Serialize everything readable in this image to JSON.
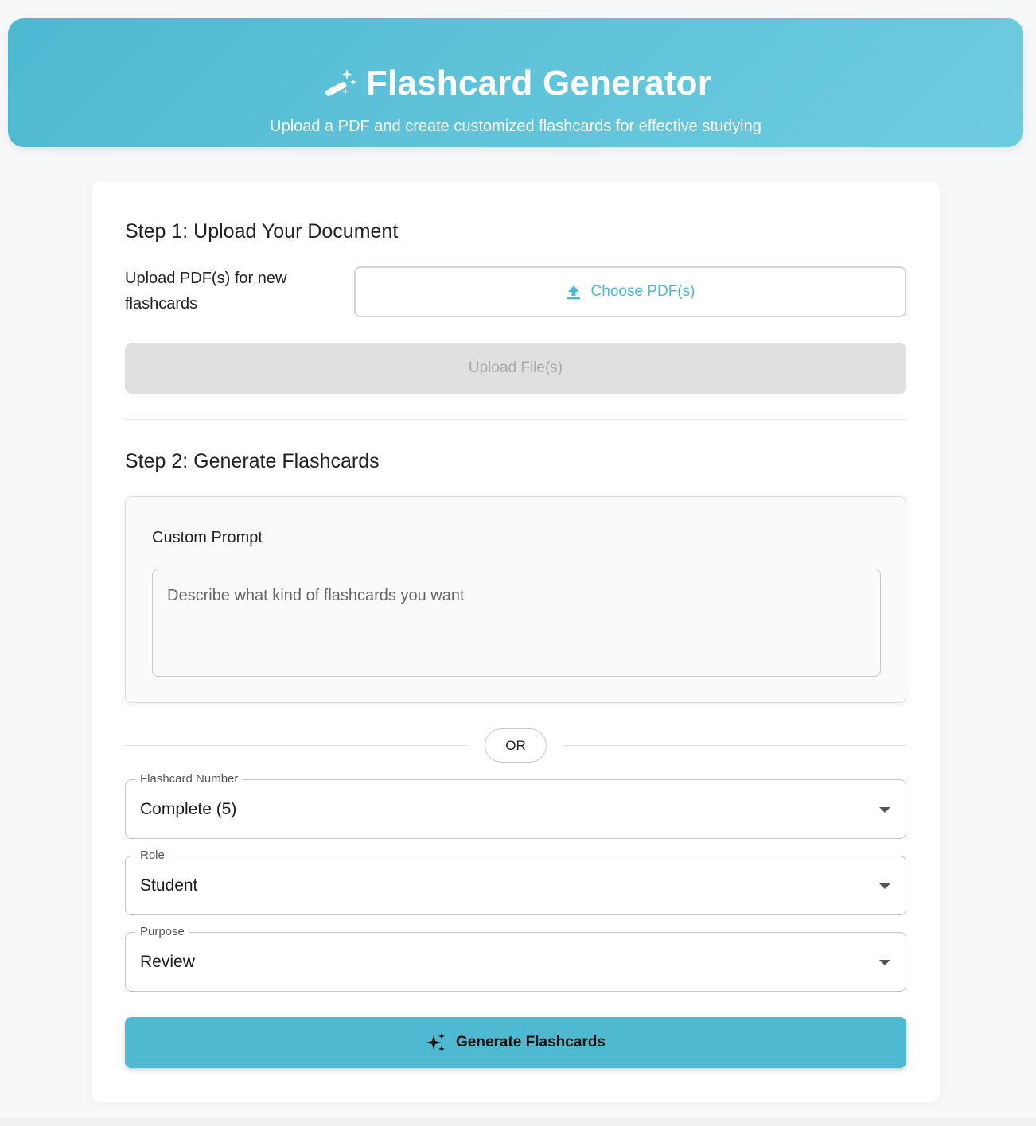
{
  "header": {
    "title": "Flashcard Generator",
    "subtitle": "Upload a PDF and create customized flashcards for effective studying",
    "icon": "magic-wand-icon"
  },
  "step1": {
    "title": "Step 1: Upload Your Document",
    "upload_label": "Upload PDF(s) for new flashcards",
    "choose_button": "Choose PDF(s)",
    "choose_icon": "upload-icon",
    "upload_button": "Upload File(s)"
  },
  "step2": {
    "title": "Step 2: Generate Flashcards",
    "custom_prompt": {
      "label": "Custom Prompt",
      "value": "",
      "placeholder": "Describe what kind of flashcards you want"
    },
    "or_label": "OR",
    "selects": [
      {
        "label": "Flashcard Number",
        "value": "Complete (5)"
      },
      {
        "label": "Role",
        "value": "Student"
      },
      {
        "label": "Purpose",
        "value": "Review"
      }
    ],
    "generate_button": "Generate Flashcards",
    "generate_icon": "sparkles-icon"
  },
  "colors": {
    "accent": "#4db8d1",
    "header_gradient_start": "#4db8d1",
    "header_gradient_end": "#6dccdf",
    "disabled_bg": "#e0e0e0",
    "disabled_text": "#a8a8a8"
  }
}
